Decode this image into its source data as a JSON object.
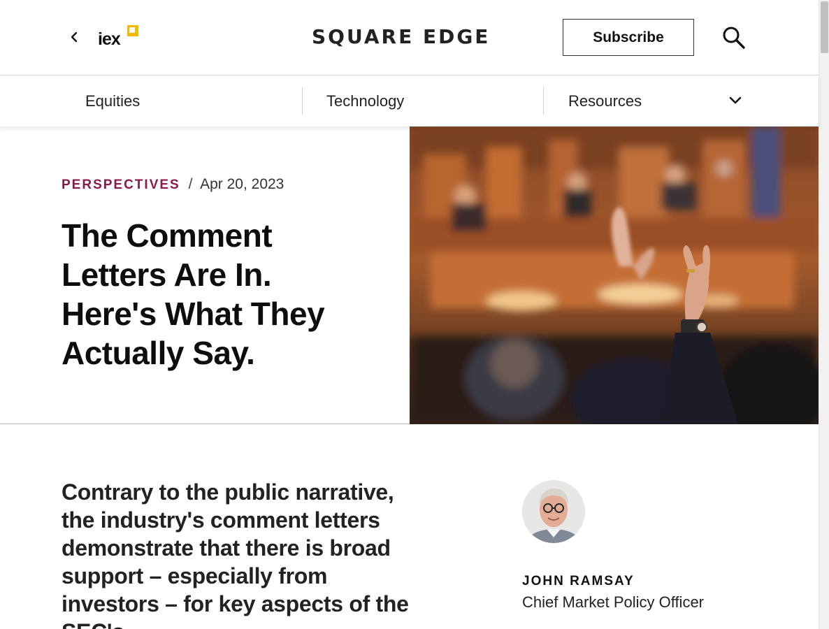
{
  "header": {
    "logo_text": "iex",
    "brand": "SQUARE EDGE",
    "subscribe_label": "Subscribe",
    "accent_color": "#f5b800"
  },
  "nav": {
    "items": [
      {
        "label": "Equities"
      },
      {
        "label": "Technology"
      },
      {
        "label": "Resources"
      }
    ]
  },
  "article": {
    "category": "PERSPECTIVES",
    "separator": "/",
    "date": "Apr 20, 2023",
    "title": "The Comment Letters Are In. Here's What They Actually Say.",
    "summary": "Contrary to the public narrative, the industry's comment letters demonstrate that there is broad support – especially from investors – for key aspects of the SEC's",
    "category_color": "#8a1a4a"
  },
  "author": {
    "name": "JOHN RAMSAY",
    "role": "Chief Market Policy Officer"
  }
}
